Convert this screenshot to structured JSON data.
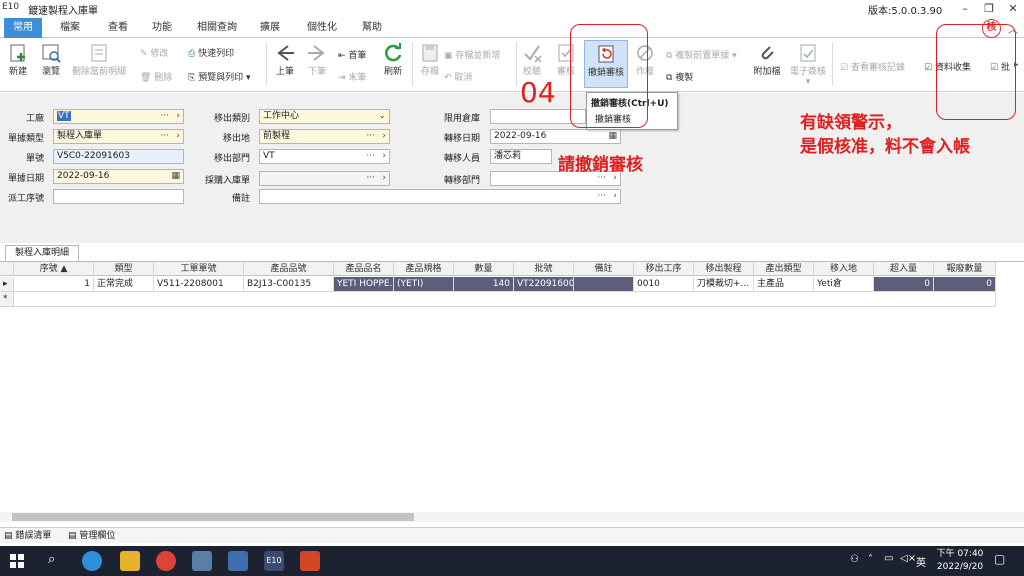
{
  "app": {
    "logo": "E10",
    "window_title": "鍍速製程入庫單",
    "version": "版本:5.0.0.3.90"
  },
  "ribbon_tabs": [
    "常用",
    "檔案",
    "查看",
    "功能",
    "相關查詢",
    "擴展",
    "個性化",
    "幫助"
  ],
  "toolbar": {
    "new": "新建",
    "browse": "瀏覽",
    "delete_current_detail": "刪除當前明細",
    "modify": "修改",
    "delete": "刪除",
    "quick_print": "快速列印",
    "preview_print": "預覽與列印",
    "prev": "上筆",
    "next": "下筆",
    "first": "首筆",
    "last": "末筆",
    "refresh": "刷新",
    "save": "存檔",
    "save_and_new": "存檔並新增",
    "cancel": "取消",
    "validate": "校驗",
    "approve": "審核",
    "revoke_approve": "撤銷審核",
    "void": "作廢",
    "copy_prev_doc": "複製前置單據",
    "copy": "複製",
    "attachment": "附加檔",
    "e_sign": "電子簽核",
    "view_approval_log": "查看審核記錄",
    "data_collect": "資料收集",
    "batch": "批"
  },
  "popup": {
    "title": "撤銷審核(Ctrl+U)",
    "desc": "撤銷審核"
  },
  "form": {
    "factory_label": "工廠",
    "factory_value": "VT",
    "doc_type_label": "單據類型",
    "doc_type_value": "製程入庫單",
    "doc_no_label": "單號",
    "doc_no_value": "V5C0-22091603",
    "doc_date_label": "單據日期",
    "doc_date_value": "2022-09-16",
    "source_no_label": "派工序號",
    "source_no_value": "",
    "out_type_label": "移出類別",
    "out_type_value": "工作中心",
    "out_place_label": "移出地",
    "out_place_value": "前製程",
    "out_dept_label": "移出部門",
    "out_dept_value": "VT",
    "purchase_in_label": "採購入庫單",
    "purchase_in_value": "",
    "remark_label": "備註",
    "remark_value": "",
    "limit_wh_label": "限用倉庫",
    "limit_wh_value": "",
    "transfer_date_label": "轉移日期",
    "transfer_date_value": "2022-09-16",
    "transfer_person_label": "轉移人員",
    "transfer_person_value": "潘芯莉",
    "transfer_dept_label": "轉移部門",
    "transfer_dept_value": ""
  },
  "detail_tab": "製程入庫明細",
  "grid": {
    "headers": [
      "序號",
      "類型",
      "工單單號",
      "產品品號",
      "產品品名",
      "產品規格",
      "數量",
      "批號",
      "備註",
      "移出工序",
      "移出製程",
      "產出類型",
      "移入地",
      "超入量",
      "報廢數量"
    ],
    "rows": [
      [
        "1",
        "正常完成",
        "V511-2208001",
        "B2J13-C00135",
        "YETI HOPPE...",
        "(YETI)",
        "140",
        "VT22091600...",
        "",
        "0010",
        "刀模裁切+...",
        "主產品",
        "Yeti倉",
        "0",
        "0"
      ]
    ]
  },
  "bottom_tabs": [
    "錯誤清單",
    "管理欄位"
  ],
  "annotations": {
    "step": "04",
    "instruction": "請撤銷審核",
    "warning_line1": "有缺領警示，",
    "warning_line2": "是假核准，料不會入帳",
    "stamp": "核"
  },
  "taskbar": {
    "lang": "英",
    "time": "下午 07:40",
    "date": "2022/9/20"
  }
}
